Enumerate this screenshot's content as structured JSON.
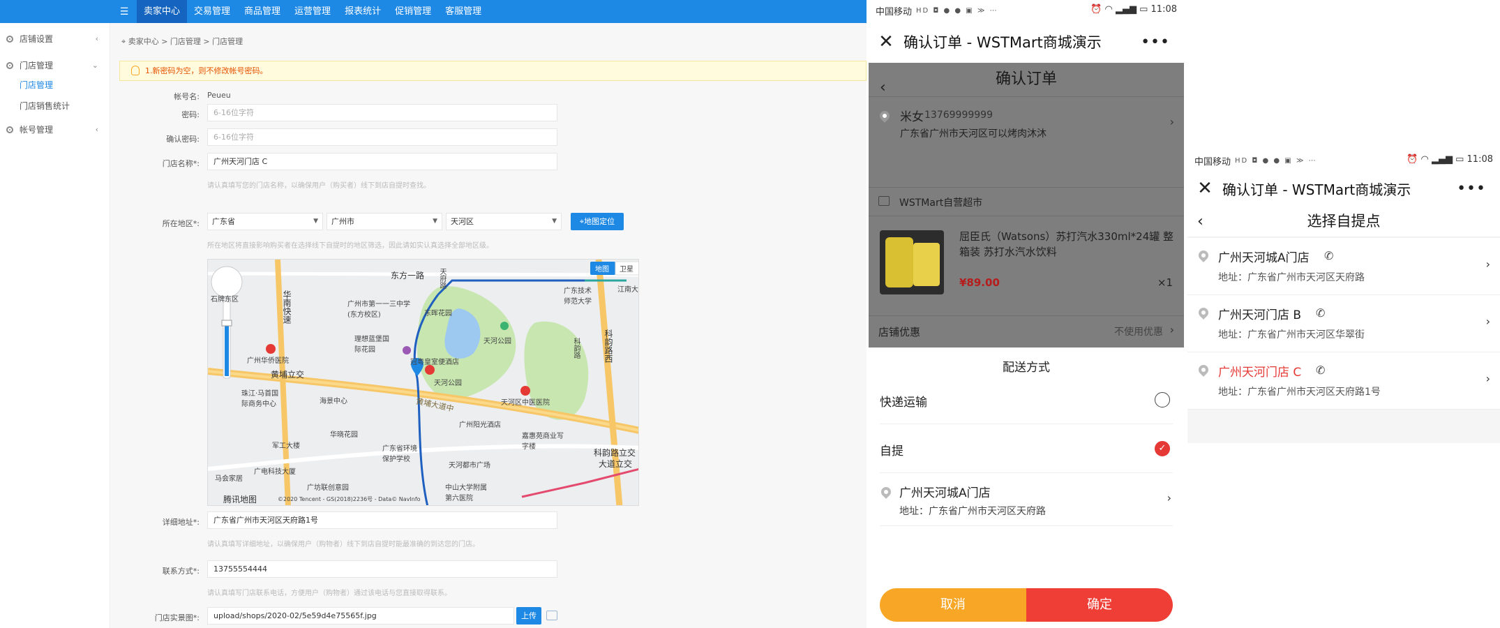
{
  "admin": {
    "topnav": [
      "卖家中心",
      "交易管理",
      "商品管理",
      "运营管理",
      "报表统计",
      "促销管理",
      "客服管理"
    ],
    "sidebar": {
      "group1": "店铺设置",
      "group2": "门店管理",
      "sub1": "门店管理",
      "sub2": "门店销售统计",
      "group3": "帐号管理"
    },
    "breadcrumb": "卖家中心 > 门店管理 > 门店管理",
    "notice": "1.新密码为空，则不修改帐号密码。",
    "form": {
      "account_label": "帐号名:",
      "account_value": "Peueu",
      "password_label": "密码:",
      "password_placeholder": "6-16位字符",
      "confirm_label": "确认密码:",
      "confirm_placeholder": "6-16位字符",
      "store_name_label": "门店名称*:",
      "store_name_value": "广州天河门店 C",
      "store_name_hint": "请认真填写您的门店名称，以确保用户（购买者）线下到店自提时查找。",
      "region_label": "所在地区*:",
      "province": "广东省",
      "city": "广州市",
      "district": "天河区",
      "locate_button": "地图定位",
      "region_hint": "所在地区将直接影响购买者在选择线下自提时的地区筛选，因此请如实认真选择全部地区级。",
      "address_label": "详细地址*:",
      "address_value": "广东省广州市天河区天府路1号",
      "address_hint": "请认真填写详细地址，以确保用户（购物者）线下到店自提时能最准确的到达您的门店。",
      "contact_label": "联系方式*:",
      "contact_value": "13755554444",
      "contact_hint": "请认真填写门店联系电话，方便用户（购物者）通过该电话与您直接取得联系。",
      "photo_label": "门店实景图*:",
      "photo_value": "upload/shops/2020-02/5e59d4e75565f.jpg",
      "upload_button": "上传"
    },
    "map": {
      "tab_map": "地图",
      "tab_sat": "卫星",
      "brand": "腾讯地图",
      "copyright": "©2020 Tencent - GS(2018)2236号 - Data© NavInfo",
      "labels": [
        "东方一路",
        "天府路",
        "广州市第一一三中学(东方校区)",
        "东晖花园",
        "理想蓝堡国际花园",
        "天河公园",
        "冠粤皇室便酒店",
        "天河公园",
        "黄埔立交",
        "广州华侨医院",
        "珠江·马首国际商务中心",
        "海景中心",
        "黄埔大道中",
        "广州阳光酒店",
        "天河区中医医院",
        "嘉惠苑商业写字楼",
        "军工大楼",
        "华晓花园",
        "广东省环境保护学校",
        "天河都市广场",
        "广电科技大厦",
        "广坊联创意园",
        "马会家居",
        "中山大学附属第六医院",
        "科韵路立交",
        "科韵路西",
        "大道立交",
        "广东技术师范大学",
        "江南大学",
        "科韵路",
        "华南快速",
        "石牌东区"
      ]
    }
  },
  "phone1": {
    "carrier": "中国移动",
    "time": "11:08",
    "title": "确认订单 - WSTMart商城演示",
    "page_title": "确认订单",
    "receiver_name": "米女",
    "receiver_phone": "13769999999",
    "receiver_addr": "广东省广州市天河区可以烤肉沐沐",
    "shop_name": "WSTMart自营超市",
    "product_name": "屈臣氏（Watsons）苏打汽水330ml*24罐 整箱装 苏打水汽水饮料",
    "product_price": "¥89.00",
    "product_qty": "×1",
    "coupon_label": "店铺优惠",
    "coupon_value": "不使用优惠",
    "sheet_title": "配送方式",
    "opt_express": "快递运输",
    "opt_pickup": "自提",
    "pickup_store": "广州天河城A门店",
    "pickup_addr": "地址：广东省广州市天河区天府路",
    "cancel": "取消",
    "confirm": "确定"
  },
  "phone2": {
    "carrier": "中国移动",
    "time": "11:08",
    "title": "确认订单 - WSTMart商城演示",
    "page_title": "选择自提点",
    "stores": [
      {
        "name": "广州天河城A门店",
        "addr": "地址：广东省广州市天河区天府路"
      },
      {
        "name": "广州天河门店 B",
        "addr": "地址：广东省广州市天河区华翠街"
      },
      {
        "name": "广州天河门店 C",
        "addr": "地址：广东省广州市天河区天府路1号"
      }
    ]
  },
  "colors": {
    "admin_blue": "#1e88e5",
    "accent_red": "#e53935",
    "accent_orange": "#f8a626"
  }
}
